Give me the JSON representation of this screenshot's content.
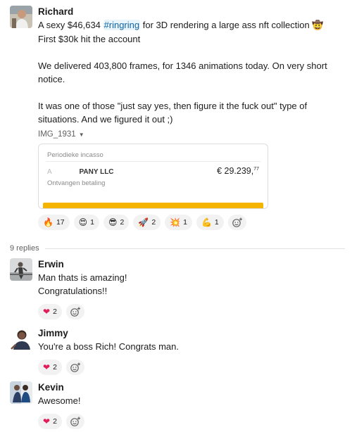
{
  "root": {
    "author": "Richard",
    "line1_before": "A sexy $46,634 ",
    "line1_hashtag": "#ringring",
    "line1_after": " for 3D rendering a large ass nft collection",
    "line1_emoji": "🤠",
    "line2": "First $30k hit the account",
    "para2": "We delivered 403,800 frames, for 1346 animations today. On very short notice.",
    "para3": "It was one of those \"just say yes, then figure it the fuck out\" type of situations. And we figured it out ;)",
    "file_name": "IMG_1931",
    "attachment": {
      "row1": "Periodieke incasso",
      "row2_prefix": "A          ",
      "row2_company": "PANY LLC",
      "amount": "€ 29.239,",
      "amount_cents": "77",
      "row3": "Ontvangen betaling"
    },
    "reactions": [
      {
        "emoji": "🔥",
        "count": "17",
        "name": "reaction-fire"
      },
      {
        "emoji": "😍",
        "count": "1",
        "name": "reaction-heart-eyes"
      },
      {
        "emoji": "😎",
        "count": "2",
        "name": "reaction-sunglasses"
      },
      {
        "emoji": "🚀",
        "count": "2",
        "name": "reaction-rocket"
      },
      {
        "emoji": "💥",
        "count": "1",
        "name": "reaction-boom"
      },
      {
        "emoji": "💪",
        "count": "1",
        "name": "reaction-muscle"
      }
    ]
  },
  "replies_label": "9 replies",
  "replies": [
    {
      "author": "Erwin",
      "lines": [
        "Man thats is amazing!",
        "Congratulations!!"
      ],
      "reaction": {
        "emoji": "❤",
        "count": "2"
      }
    },
    {
      "author": "Jimmy",
      "lines": [
        "You're a boss Rich! Congrats man."
      ],
      "reaction": {
        "emoji": "❤",
        "count": "2"
      }
    },
    {
      "author": "Kevin",
      "lines": [
        "Awesome!"
      ],
      "reaction": {
        "emoji": "❤",
        "count": "2"
      }
    }
  ],
  "colors": {
    "hashtag": "#1264a3",
    "hashtag_bg": "#e8f5fa",
    "attachment_bar": "#f4b400",
    "heart": "#e01e5a"
  },
  "icons": {
    "add_reaction": "add-reaction-icon",
    "dropdown": "chevron-down-icon"
  }
}
